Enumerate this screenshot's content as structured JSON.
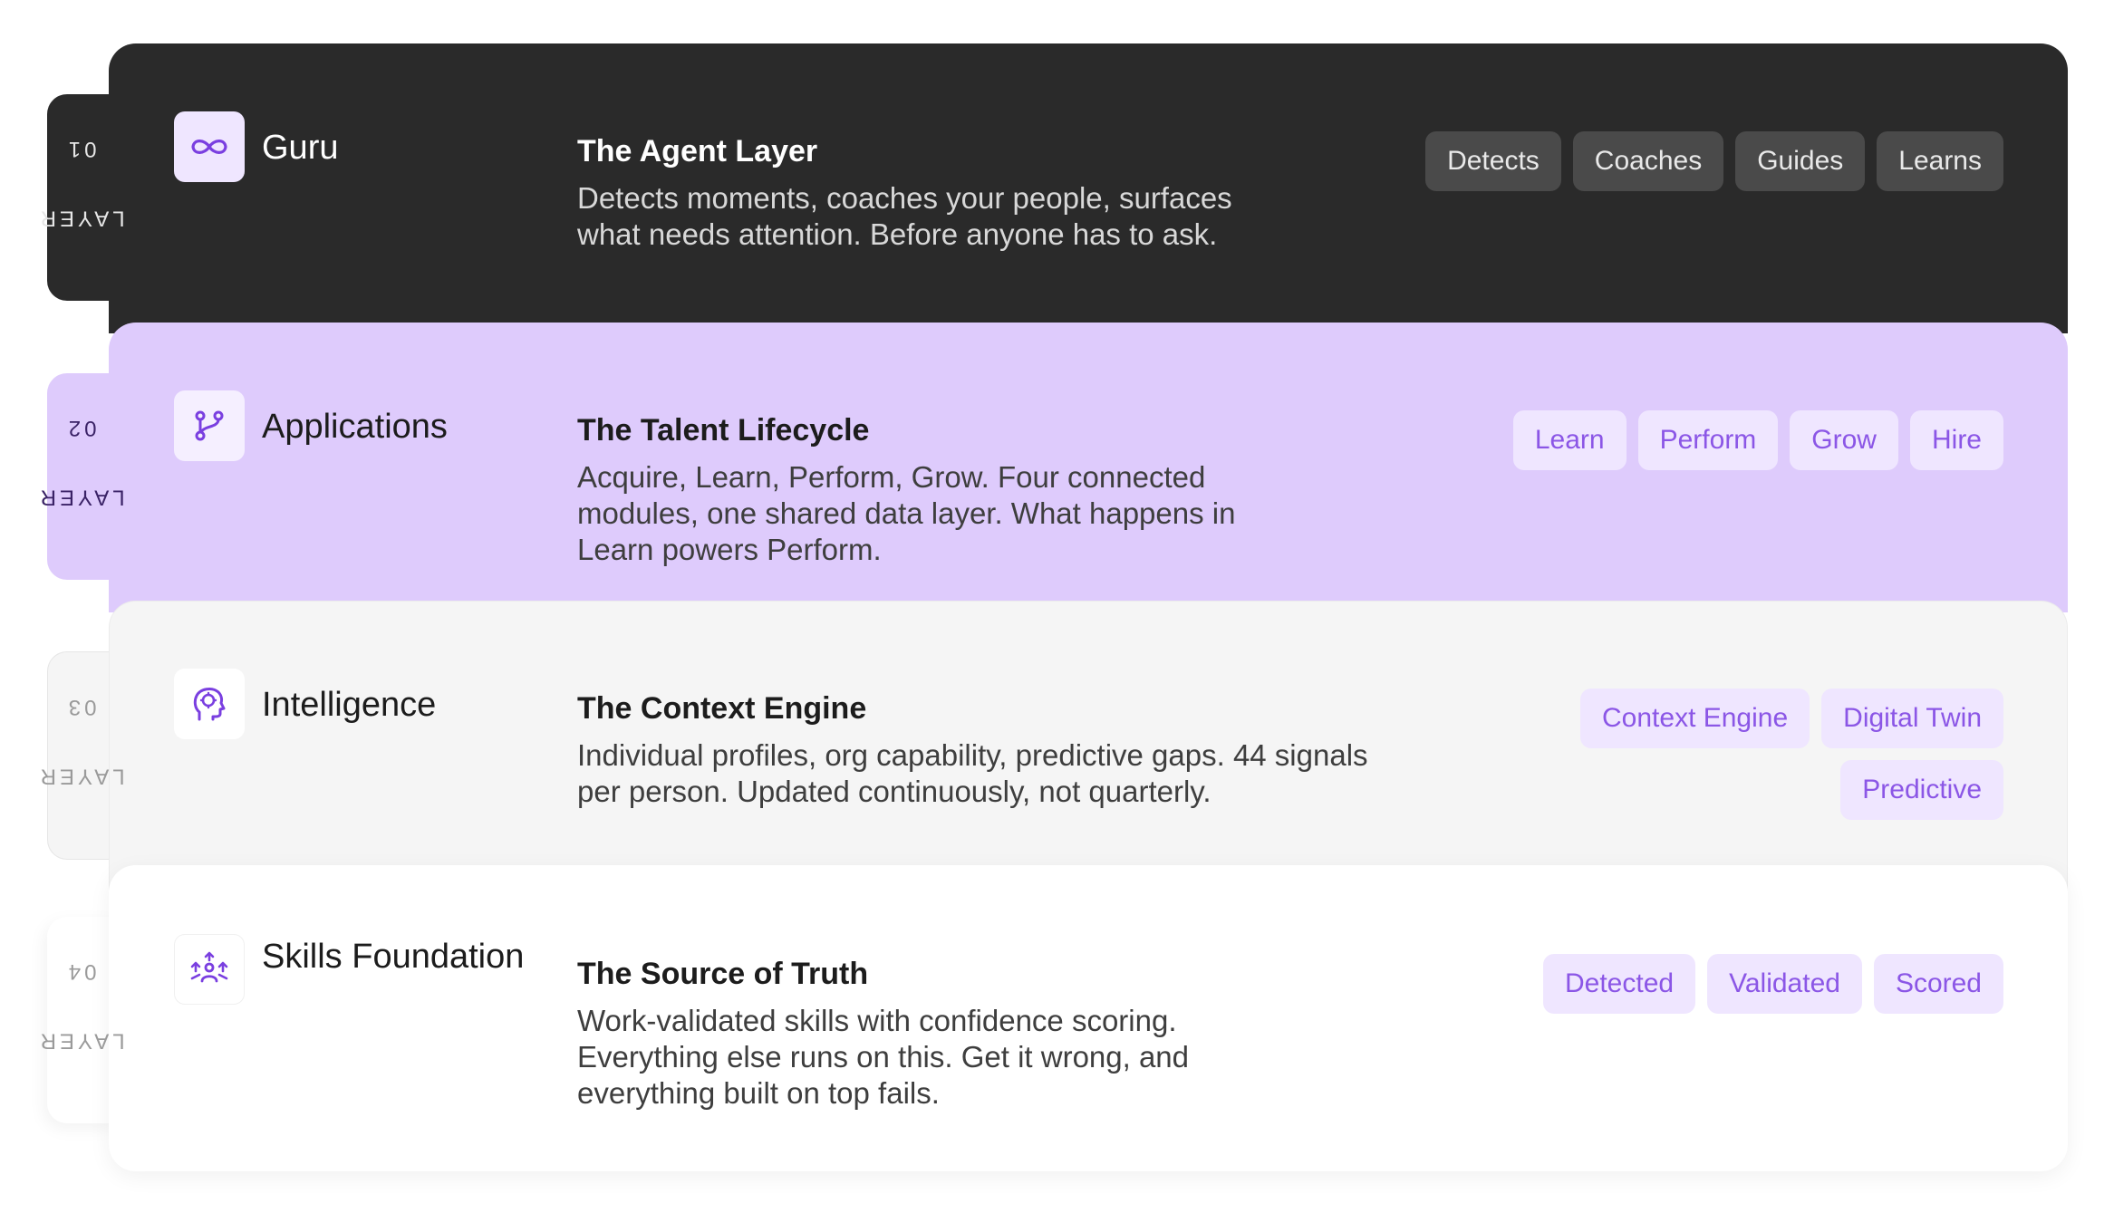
{
  "layers": [
    {
      "tab_word": "LAYER",
      "tab_number": "01",
      "name": "Guru",
      "icon": "infinity-icon",
      "subtitle": "The Agent Layer",
      "description": "Detects moments, coaches your people, surfaces what needs attention. Before anyone has to ask.",
      "chips": [
        "Detects",
        "Coaches",
        "Guides",
        "Learns"
      ]
    },
    {
      "tab_word": "LAYER",
      "tab_number": "02",
      "name": "Applications",
      "icon": "git-branch-icon",
      "subtitle": "The Talent Lifecycle",
      "description": "Acquire, Learn, Perform, Grow. Four connected modules, one shared data layer. What happens in Learn powers Perform.",
      "chips": [
        "Learn",
        "Perform",
        "Grow",
        "Hire"
      ]
    },
    {
      "tab_word": "LAYER",
      "tab_number": "03",
      "name": "Intelligence",
      "icon": "brain-head-icon",
      "subtitle": "The Context Engine",
      "description": "Individual profiles, org capability, predictive gaps. 44 signals per person. Updated continuously, not quarterly.",
      "chips": [
        "Context Engine",
        "Digital Twin",
        "Predictive"
      ]
    },
    {
      "tab_word": "LAYER",
      "tab_number": "04",
      "name": "Skills Foundation",
      "icon": "people-growth-icon",
      "subtitle": "The Source of Truth",
      "description": "Work-validated skills with confidence scoring. Everything else runs on this. Get it wrong, and everything built on top fails.",
      "chips": [
        "Detected",
        "Validated",
        "Scored"
      ]
    }
  ],
  "colors": {
    "accent": "#7a3fe0",
    "dark_card": "#2a2a2a",
    "lavender_card": "#decbfc",
    "gray_card": "#f5f5f5",
    "chip_lavender": "#efe6ff"
  }
}
